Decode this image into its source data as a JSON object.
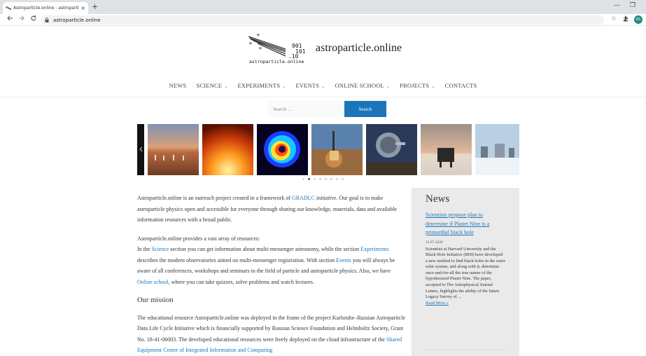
{
  "browser": {
    "tab_title": "Astroparticle.online - astropartic",
    "tab_close": "×",
    "new_tab": "+",
    "url": "astroparticle.online",
    "avatar_initials": "KS",
    "minimize": "—",
    "restore": "❐",
    "back_icon": "arrow-left",
    "forward_icon": "arrow-right",
    "reload_icon": "reload",
    "star_icon": "star",
    "extensions_icon": "puzzle"
  },
  "site": {
    "logo_digits": [
      "001",
      "101",
      ".10"
    ],
    "logo_caption": "astroparticle.online",
    "title": "astroparticle.online"
  },
  "nav": {
    "items": [
      {
        "label": "NEWS",
        "dropdown": false
      },
      {
        "label": "SCIENCE",
        "dropdown": true
      },
      {
        "label": "EXPERIMENTS",
        "dropdown": true
      },
      {
        "label": "EVENTS",
        "dropdown": true
      },
      {
        "label": "ONLINE SCHOOL",
        "dropdown": true
      },
      {
        "label": "PROJECTS",
        "dropdown": true
      },
      {
        "label": "CONTACTS",
        "dropdown": false
      }
    ],
    "chevron": "⌄"
  },
  "search": {
    "placeholder": "Search …",
    "button": "Search"
  },
  "carousel": {
    "active_dot": 1,
    "dot_count": 8
  },
  "content": {
    "intro_pre": "Astroparticle.online is an outreach project created in a framework of ",
    "intro_link": "GRADLC",
    "intro_post": " initiative. Our goal is to make astroparticle physics open and accessible for everyone through sharing our knowledge, materials, data and available information resources with a broad public.",
    "res_line1": "Astroparticle.online provides a vast array of resources:",
    "res_a": "In the ",
    "res_science": "Science",
    "res_b": " section you can get information about multi-messenger astronomy, while the section ",
    "res_experiments": "Experiments",
    "res_c": " describes the modern observatories aimed on multi-messenger registration. With section ",
    "res_events": "Events",
    "res_d": " you will always be aware of all conferences, workshops and seminars in the field of particle and astroparticle physics. Also, we have ",
    "res_school": "Online school",
    "res_e": ", where you can take quizzes, solve problems and watch lectures.",
    "mission_heading": "Our mission",
    "mission_text": "The educational resource Astroparticle.online was deployed in the frame of the project Karlsruhe–Russian Astroparticle Data Life Cycle Initiative which is financially supported by Russian Science Foundation and Helmholtz Society, Grant No. 18-41-06003. The developed educational resources were freely deployed on the cloud infrastructure of the ",
    "mission_link": "Shared Equipment Center of Integrated Information and Computing"
  },
  "sidebar": {
    "heading": "News",
    "news_title": "Scientists propose plan to determine if Planet Nine is a primordial black hole",
    "news_date": "15.07.2020",
    "news_excerpt": "Scientists at Harvard University and the Black Hole Initiative (BHI) have developed a new method to find black holes in the outer solar system, and along with it, determine once-and-for-all the true nature of the hypothesized Planet Nine. The paper, accepted to The Astrophysical Journal Letters, highlights the ability of the future Legacy Survey of ...",
    "read_more": "Read More »"
  },
  "colors": {
    "link": "#1b75bb",
    "search_button": "#1b75bb",
    "sidebar_bg": "#eaeaea",
    "tabbar_bg": "#dee1e6",
    "avatar": "#1e8e7e"
  }
}
